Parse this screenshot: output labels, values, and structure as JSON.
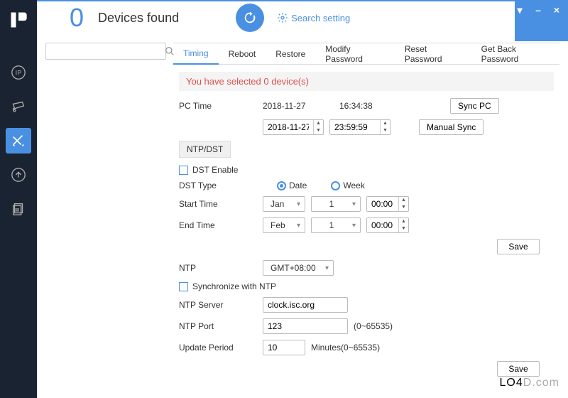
{
  "header": {
    "device_count": "0",
    "devices_label": "Devices found",
    "search_setting": "Search setting"
  },
  "tabs": [
    "Timing",
    "Reboot",
    "Restore",
    "Modify Password",
    "Reset Password",
    "Get Back Password"
  ],
  "active_tab": "Timing",
  "message": "You have selected 0 device(s)",
  "timing": {
    "pc_time_label": "PC Time",
    "pc_date": "2018-11-27",
    "pc_time": "16:34:38",
    "sync_pc": "Sync PC",
    "date_input": "2018-11-27",
    "time_input": "23:59:59",
    "manual_sync": "Manual Sync",
    "subtab": "NTP/DST",
    "dst_enable": "DST Enable",
    "dst_type_label": "DST Type",
    "dst_date": "Date",
    "dst_week": "Week",
    "start_time_label": "Start Time",
    "start_month": "Jan",
    "start_day": "1",
    "start_hhmm": "00:00",
    "end_time_label": "End Time",
    "end_month": "Feb",
    "end_day": "1",
    "end_hhmm": "00:00",
    "save": "Save",
    "ntp_label": "NTP",
    "ntp_tz": "GMT+08:00",
    "sync_ntp": "Synchronize with NTP",
    "ntp_server_label": "NTP Server",
    "ntp_server": "clock.isc.org",
    "ntp_port_label": "NTP Port",
    "ntp_port": "123",
    "port_range": "(0~65535)",
    "update_period_label": "Update Period",
    "update_period": "10",
    "period_unit": "Minutes(0~65535)"
  },
  "watermark_a": "LO4",
  "watermark_b": "D.com"
}
